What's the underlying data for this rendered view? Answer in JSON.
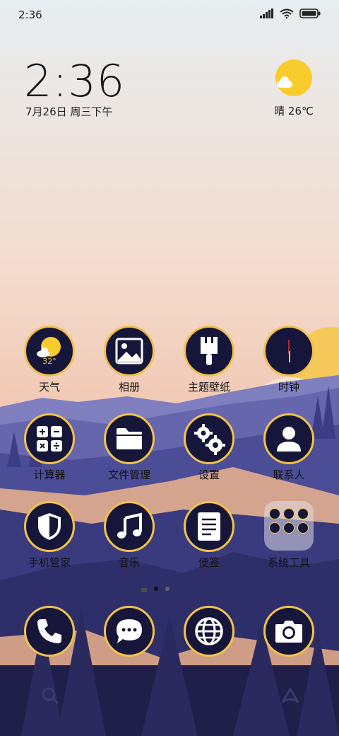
{
  "status_bar": {
    "time": "2:36"
  },
  "clock_widget": {
    "time": "2:36",
    "date": "7月26日 周三下午"
  },
  "weather_widget": {
    "text": "晴 26℃"
  },
  "apps": {
    "weather": {
      "label": "天气",
      "temp": "32°"
    },
    "gallery": {
      "label": "相册"
    },
    "themes": {
      "label": "主题壁纸"
    },
    "clock": {
      "label": "时钟"
    },
    "calculator": {
      "label": "计算器"
    },
    "files": {
      "label": "文件管理"
    },
    "settings": {
      "label": "设置"
    },
    "contacts": {
      "label": "联系人"
    },
    "security": {
      "label": "手机管家"
    },
    "music": {
      "label": "音乐"
    },
    "notes": {
      "label": "便签"
    },
    "tools_folder": {
      "label": "系统工具"
    }
  },
  "dock": [
    "phone",
    "messages",
    "browser",
    "camera"
  ],
  "colors": {
    "icon_bg": "#16163a",
    "icon_ring": "#f0c24b",
    "sun": "#f9cc2e"
  }
}
